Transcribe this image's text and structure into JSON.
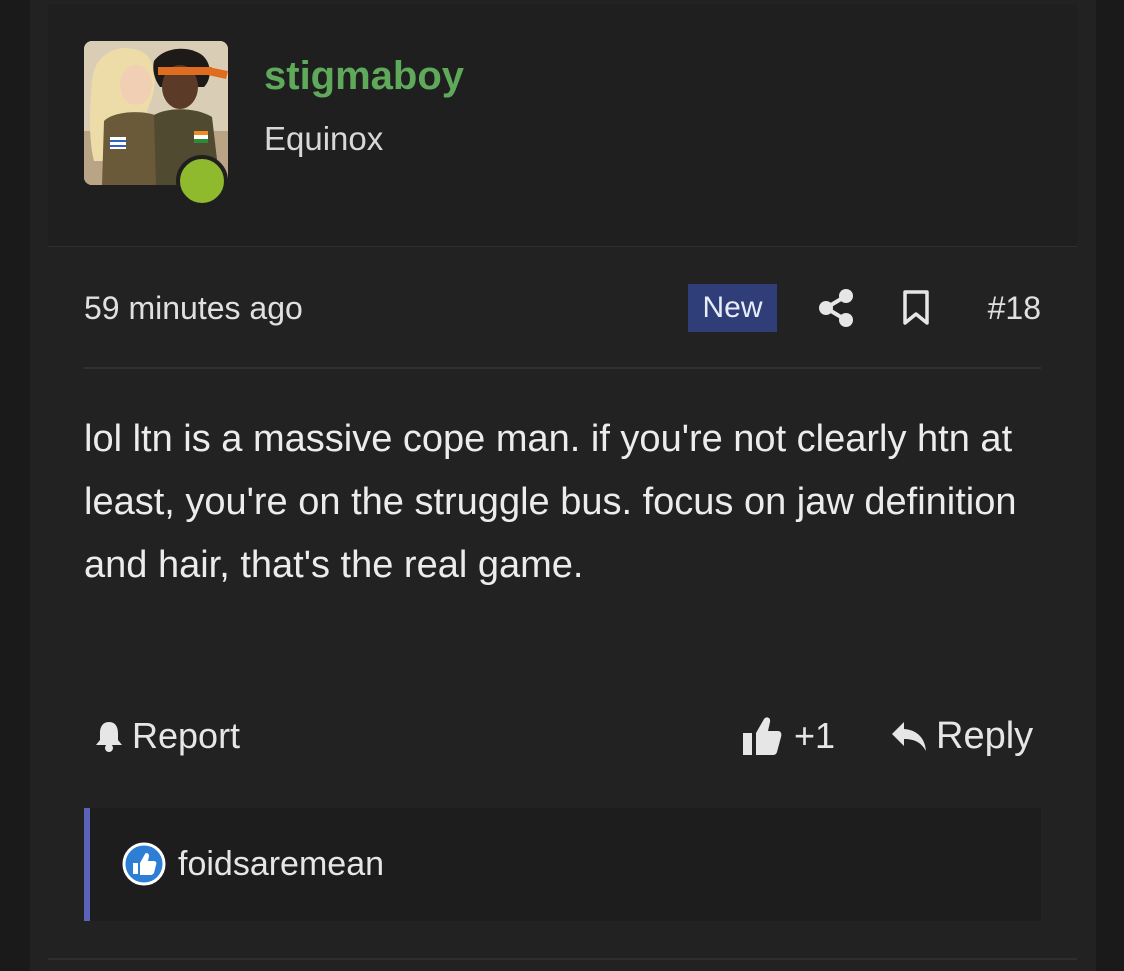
{
  "user": {
    "username": "stigmaboy",
    "title": "Equinox",
    "online": true,
    "username_color": "#5fa95b",
    "online_color": "#8fba2e"
  },
  "post": {
    "time": "59 minutes ago",
    "badge": "New",
    "number": "#18",
    "body": "lol ltn is a massive cope man. if you're not clearly htn at least, you're on the struggle bus. focus on jaw definition and hair, that's the real game."
  },
  "actions": {
    "report_label": "Report",
    "like_count": "+1",
    "reply_label": "Reply"
  },
  "reactions": {
    "users": [
      "foidsaremean"
    ]
  },
  "icons": {
    "share": "share-icon",
    "bookmark": "bookmark-icon",
    "report": "bell-icon",
    "like": "thumbs-up-icon",
    "reply": "reply-arrow-icon",
    "reaction": "like-reaction-icon"
  },
  "colors": {
    "badge_bg": "#2f3e78",
    "reaction_border": "#5a63b8"
  }
}
